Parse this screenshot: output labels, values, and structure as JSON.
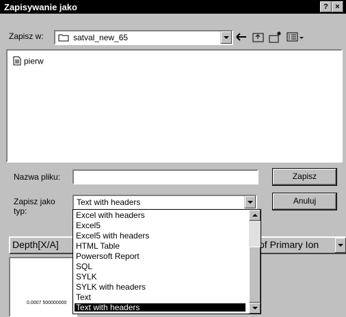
{
  "window": {
    "title": "Zapisywanie jako",
    "help_btn": "?",
    "close_btn": "×"
  },
  "save_in": {
    "label": "Zapisz w:",
    "value": "satval_new_65",
    "icon": "folder-icon"
  },
  "toolbar": {
    "back_icon": "back-arrow-icon",
    "up_icon": "up-folder-icon",
    "new_folder_icon": "new-folder-icon",
    "view_menu_icon": "view-menu-icon"
  },
  "files": [
    {
      "name": "pierw",
      "icon": "document-icon"
    }
  ],
  "filename": {
    "label": "Nazwa pliku:",
    "value": ""
  },
  "filetype": {
    "label_line1": "Zapisz jako",
    "label_line2": "typ:",
    "value": "Text with headers",
    "options": [
      "Excel with headers",
      "Excel5",
      "Excel5 with headers",
      "HTML Table",
      "Powersoft Report",
      "SQL",
      "SYLK",
      "SYLK with headers",
      "Text",
      "Text with headers"
    ],
    "selected_index": 9
  },
  "buttons": {
    "save": "Zapisz",
    "cancel": "Anuluj"
  },
  "background": {
    "left_label": "Depth[X/A]",
    "right_label": "of Primary Ion",
    "plot_value": "0.0007 500000000"
  }
}
